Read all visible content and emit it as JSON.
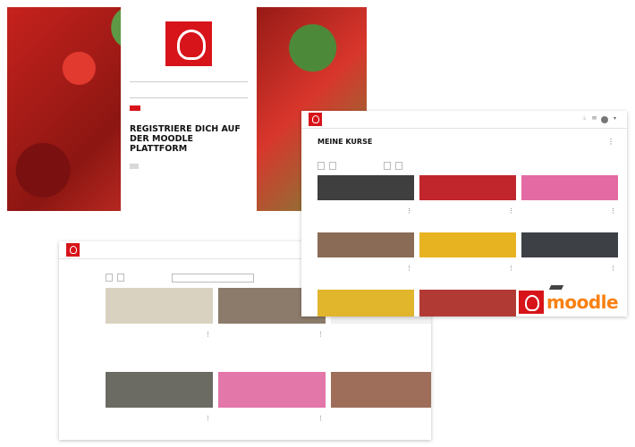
{
  "login": {
    "username_placeholder": "",
    "password_placeholder": "",
    "login_button": "",
    "forgot_link": "",
    "register_kicker": "",
    "register_title": "REGISTRIERE DICH AUF DER MOODLE PLATTFORM",
    "register_text": "",
    "register_button": ""
  },
  "kurse": {
    "nav": [
      "",
      "",
      "",
      ""
    ],
    "title": "MEINE KURSE",
    "subtitle": "",
    "filters": [
      "",
      "",
      "",
      ""
    ],
    "cards": [
      {
        "title": "",
        "text": "",
        "color": "#3f3f3f"
      },
      {
        "title": "",
        "text": "",
        "color": "#c0262c"
      },
      {
        "title": "",
        "text": "",
        "color": "#e46aa4"
      },
      {
        "title": "",
        "text": "",
        "color": "#8a6b55"
      },
      {
        "title": "",
        "text": "",
        "color": "#e8b321"
      },
      {
        "title": "",
        "text": "",
        "color": "#3d4146"
      },
      {
        "title": "",
        "text": "",
        "color": "#e1b52c"
      },
      {
        "title": "",
        "text": "",
        "color": "#b23a35"
      }
    ]
  },
  "bottom": {
    "nav": [
      "",
      "",
      "",
      "",
      ""
    ],
    "filters": [
      "",
      ""
    ],
    "search_placeholder": "",
    "cards": [
      {
        "title": "",
        "text": "",
        "color": "#d9d2c0"
      },
      {
        "title": "",
        "text": "",
        "color": "#8c7b6a"
      },
      {
        "title": "",
        "text": "",
        "color": "#f0f0f0"
      },
      {
        "title": "",
        "text": "",
        "color": "#6b6b63"
      },
      {
        "title": "",
        "text": "",
        "color": "#e377a9"
      },
      {
        "title": "",
        "text": "",
        "color": "#9e6e5a"
      }
    ]
  },
  "brand": {
    "name": "moodle",
    "colors": {
      "accent": "#d7141a",
      "moodle_orange": "#f98012"
    }
  }
}
